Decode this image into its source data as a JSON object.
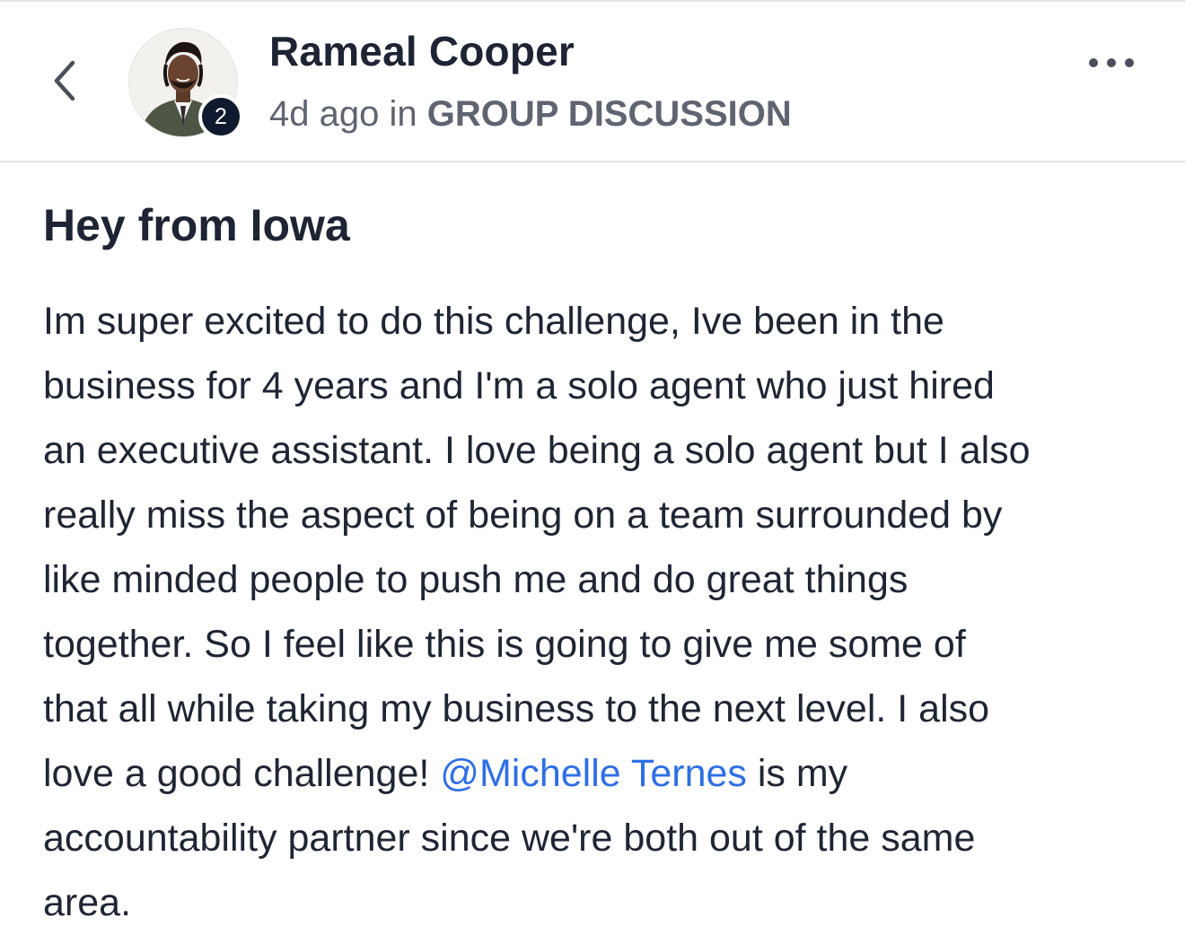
{
  "header": {
    "back_icon": "chevron-left-icon",
    "author_name": "Rameal Cooper",
    "avatar_badge": "2",
    "time_ago": "4d ago",
    "in_word": "in",
    "group_name": "GROUP DISCUSSION",
    "more_icon": "more-horizontal-icon"
  },
  "post": {
    "title": "Hey from Iowa",
    "body_lines": [
      "Im super excited to do this challenge, Ive been in the",
      "business for 4 years and I'm a solo agent who just hired",
      "an executive assistant. I love being a solo agent but I also",
      "really miss the aspect of being on a team surrounded by",
      "like minded people to push me and do great things",
      "together. So I feel like this is going to give me some of",
      "that all while taking my business to the next level. I also"
    ],
    "mention_line_before": "love a good challenge!",
    "mention": "@Michelle Ternes",
    "mention_line_after": "is my",
    "body_tail": [
      "accountability partner since we're both out of the same",
      "area."
    ]
  },
  "colors": {
    "text": "#1f2533",
    "meta": "#5f6470",
    "mention": "#2f6fe4",
    "badge": "#0f1a2e",
    "divider": "#e3e5e8"
  }
}
